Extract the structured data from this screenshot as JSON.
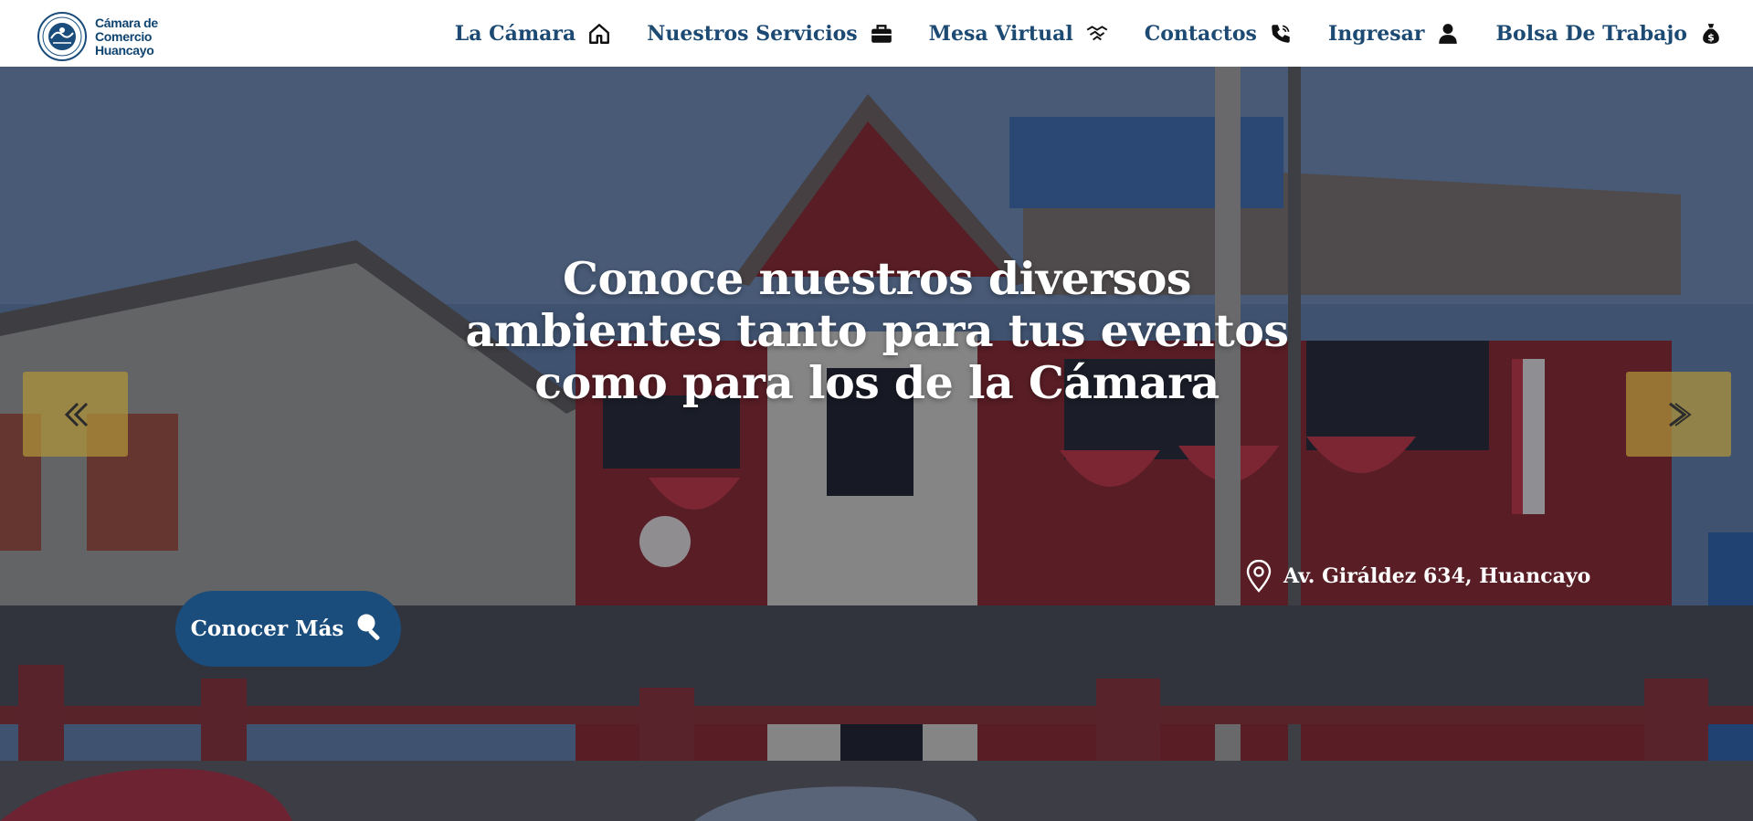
{
  "header": {
    "logo": {
      "line1": "Cámara de",
      "line2": "Comercio",
      "line3": "Huancayo"
    },
    "nav": [
      {
        "label": "La Cámara",
        "icon": "home-icon"
      },
      {
        "label": "Nuestros Servicios",
        "icon": "briefcase-icon"
      },
      {
        "label": "Mesa Virtual",
        "icon": "handshake-icon"
      },
      {
        "label": "Contactos",
        "icon": "phone-icon"
      },
      {
        "label": "Ingresar",
        "icon": "user-icon"
      },
      {
        "label": "Bolsa De Trabajo",
        "icon": "money-bag-icon"
      }
    ]
  },
  "hero": {
    "title": "Conoce nuestros diversos ambientes tanto para tus eventos como para los de la Cámara",
    "address": "Av. Giráldez 634, Huancayo",
    "cta_label": "Conocer Más",
    "cta_icon": "search-icon",
    "prev_icon": "chevron-double-left-icon",
    "next_icon": "chevron-right-icon"
  },
  "colors": {
    "brand_blue": "#1a4d7c",
    "nav_text": "#1d4a72",
    "carousel_button": "#b0943a",
    "header_bg": "#ffffff"
  }
}
